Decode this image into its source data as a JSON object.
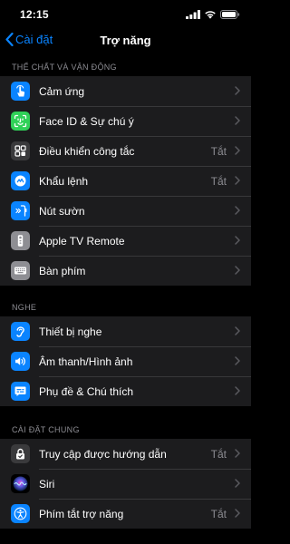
{
  "status_bar": {
    "time": "12:15"
  },
  "nav": {
    "back_label": "Cài đặt",
    "title": "Trợ năng"
  },
  "sections": {
    "physical": "THỂ CHẤT VÀ VẬN ĐỘNG",
    "hearing": "NGHE",
    "general": "CÀI ĐẶT CHUNG"
  },
  "physical_items": [
    {
      "label": "Cảm ứng",
      "value": "",
      "icon": "touch-icon",
      "color": "#0a84ff"
    },
    {
      "label": "Face ID & Sự chú ý",
      "value": "",
      "icon": "face-id-icon",
      "color": "#30d158"
    },
    {
      "label": "Điều khiển công tắc",
      "value": "Tắt",
      "icon": "switch-control-icon",
      "color": "#3a3a3c"
    },
    {
      "label": "Khẩu lệnh",
      "value": "Tắt",
      "icon": "voice-control-icon",
      "color": "#0a84ff"
    },
    {
      "label": "Nút sườn",
      "value": "",
      "icon": "side-button-icon",
      "color": "#0a84ff"
    },
    {
      "label": "Apple TV Remote",
      "value": "",
      "icon": "tv-remote-icon",
      "color": "#8e8e93"
    },
    {
      "label": "Bàn phím",
      "value": "",
      "icon": "keyboard-icon",
      "color": "#8e8e93"
    }
  ],
  "hearing_items": [
    {
      "label": "Thiết bị nghe",
      "value": "",
      "icon": "ear-icon",
      "color": "#0a84ff"
    },
    {
      "label": "Âm thanh/Hình ảnh",
      "value": "",
      "icon": "audio-visual-icon",
      "color": "#0a84ff"
    },
    {
      "label": "Phụ đề & Chú thích",
      "value": "",
      "icon": "subtitles-icon",
      "color": "#0a84ff"
    }
  ],
  "general_items": [
    {
      "label": "Truy cập được hướng dẫn",
      "value": "Tắt",
      "icon": "guided-access-icon",
      "color": "#3a3a3c"
    },
    {
      "label": "Siri",
      "value": "",
      "icon": "siri-icon",
      "color": "#000000"
    },
    {
      "label": "Phím tắt trợ năng",
      "value": "Tắt",
      "icon": "accessibility-icon",
      "color": "#0a84ff"
    }
  ]
}
